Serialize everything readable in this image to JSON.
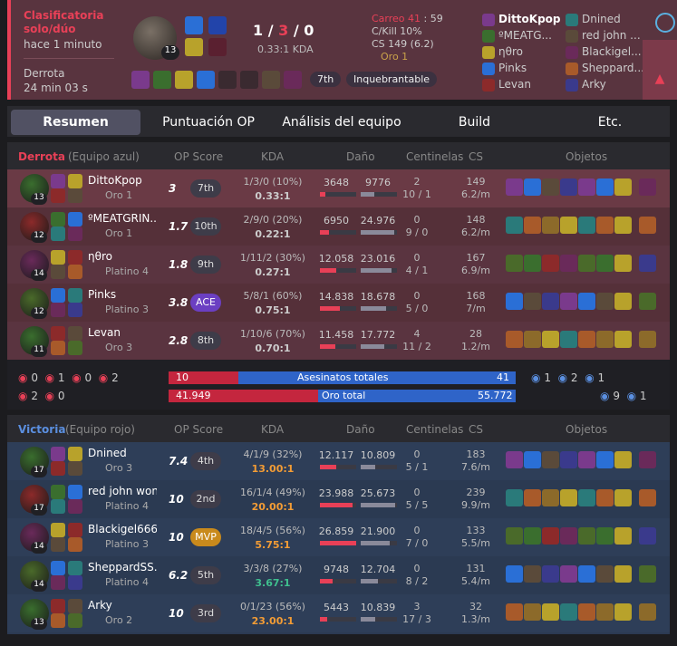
{
  "summary": {
    "queue": "Clasificatoria solo/dúo",
    "ago": "hace 1 minuto",
    "result": "Derrota",
    "duration": "24 min 03 s",
    "champ_level": "13",
    "kills": "1",
    "deaths": "3",
    "assists": "0",
    "kda_ratio": "0.33:1 KDA",
    "placement": "7th",
    "badge": "Inquebrantable",
    "carry": "Carreo 41",
    "carry_time": "59",
    "ckill": "C/Kill 10%",
    "cs": "CS 149 (6.2)",
    "tier": "Oro 1",
    "team_blue": [
      "DittoKpop",
      "ºMEATG...",
      "ηθro",
      "Pinks",
      "Levan"
    ],
    "team_red": [
      "Dnined",
      "red john ...",
      "Blackigel...",
      "Sheppard...",
      "Arky"
    ]
  },
  "tabs": [
    "Resumen",
    "Puntuación OP",
    "Análisis del equipo",
    "Build",
    "Etc."
  ],
  "blue": {
    "result": "Derrota",
    "team_label": "(Equipo azul)",
    "headers": [
      "OP Score",
      "KDA",
      "Daño",
      "Centinelas",
      "CS",
      "Objetos"
    ],
    "players": [
      {
        "name": "DittoKpop",
        "rank": "Oro 1",
        "lvl": "13",
        "score": "3",
        "place": "7th",
        "kda": "1/3/0 (10%)",
        "ratio": "0.33:1",
        "dmg1": "3648",
        "dmg2": "9776",
        "f1": 0.14,
        "f2": 0.38,
        "wards": "2",
        "wards2": "10 / 1",
        "cs": "149",
        "csm": "6.2/m"
      },
      {
        "name": "ºMEATGRIN...",
        "rank": "Oro 1",
        "lvl": "12",
        "score": "1.7",
        "place": "10th",
        "kda": "2/9/0 (20%)",
        "ratio": "0.22:1",
        "dmg1": "6950",
        "dmg2": "24.976",
        "f1": 0.26,
        "f2": 0.93,
        "wards": "0",
        "wards2": "9 / 0",
        "cs": "148",
        "csm": "6.2/m"
      },
      {
        "name": "ηθro",
        "rank": "Platino 4",
        "lvl": "14",
        "score": "1.8",
        "place": "9th",
        "kda": "1/11/2 (30%)",
        "ratio": "0.27:1",
        "dmg1": "12.058",
        "dmg2": "23.016",
        "f1": 0.45,
        "f2": 0.86,
        "wards": "0",
        "wards2": "4 / 1",
        "cs": "167",
        "csm": "6.9/m"
      },
      {
        "name": "Pinks",
        "rank": "Platino 3",
        "lvl": "12",
        "score": "3.8",
        "place": "ACE",
        "kda": "5/8/1 (60%)",
        "ratio": "0.75:1",
        "dmg1": "14.838",
        "dmg2": "18.678",
        "f1": 0.55,
        "f2": 0.7,
        "wards": "0",
        "wards2": "5 / 0",
        "cs": "168",
        "csm": "7/m"
      },
      {
        "name": "Levan",
        "rank": "Oro 3",
        "lvl": "11",
        "score": "2.8",
        "place": "8th",
        "kda": "1/10/6 (70%)",
        "ratio": "0.70:1",
        "dmg1": "11.458",
        "dmg2": "17.772",
        "f1": 0.43,
        "f2": 0.66,
        "wards": "4",
        "wards2": "11 / 2",
        "cs": "28",
        "csm": "1.2/m"
      }
    ]
  },
  "objectives": {
    "blue_top": [
      "0",
      "1",
      "0",
      "2"
    ],
    "blue_bot": [
      "2",
      "0"
    ],
    "red_top": [
      "1",
      "2",
      "1"
    ],
    "red_bot": [
      "9",
      "1"
    ],
    "kills_left": "10",
    "kills_label": "Asesinatos totales",
    "kills_right": "41",
    "gold_left": "41.949",
    "gold_label": "Oro total",
    "gold_right": "55.772",
    "kills_frac": 0.2,
    "gold_frac": 0.43
  },
  "red": {
    "result": "Victoria",
    "team_label": "(Equipo rojo)",
    "headers": [
      "OP Score",
      "KDA",
      "Daño",
      "Centinelas",
      "CS",
      "Objetos"
    ],
    "players": [
      {
        "name": "Dnined",
        "rank": "Oro 3",
        "lvl": "17",
        "score": "7.4",
        "place": "4th",
        "kda": "4/1/9 (32%)",
        "ratio": "13.00:1",
        "dmg1": "12.117",
        "dmg2": "10.809",
        "f1": 0.45,
        "f2": 0.4,
        "wards": "0",
        "wards2": "5 / 1",
        "cs": "183",
        "csm": "7.6/m"
      },
      {
        "name": "red john won",
        "rank": "Platino 4",
        "lvl": "17",
        "score": "10",
        "place": "2nd",
        "kda": "16/1/4 (49%)",
        "ratio": "20.00:1",
        "dmg1": "23.988",
        "dmg2": "25.673",
        "f1": 0.89,
        "f2": 0.95,
        "wards": "0",
        "wards2": "5 / 5",
        "cs": "239",
        "csm": "9.9/m"
      },
      {
        "name": "Blackigel666",
        "rank": "Platino 3",
        "lvl": "14",
        "score": "10",
        "place": "MVP",
        "kda": "18/4/5 (56%)",
        "ratio": "5.75:1",
        "dmg1": "26.859",
        "dmg2": "21.900",
        "f1": 1.0,
        "f2": 0.81,
        "wards": "0",
        "wards2": "7 / 0",
        "cs": "133",
        "csm": "5.5/m"
      },
      {
        "name": "SheppardSS...",
        "rank": "Platino 4",
        "lvl": "14",
        "score": "6.2",
        "place": "5th",
        "kda": "3/3/8 (27%)",
        "ratio": "3.67:1",
        "dmg1": "9748",
        "dmg2": "12.704",
        "f1": 0.36,
        "f2": 0.47,
        "wards": "0",
        "wards2": "8 / 2",
        "cs": "131",
        "csm": "5.4/m"
      },
      {
        "name": "Arky",
        "rank": "Oro 2",
        "lvl": "13",
        "score": "10",
        "place": "3rd",
        "kda": "0/1/23 (56%)",
        "ratio": "23.00:1",
        "dmg1": "5443",
        "dmg2": "10.839",
        "f1": 0.2,
        "f2": 0.4,
        "wards": "3",
        "wards2": "17 / 3",
        "cs": "32",
        "csm": "1.3/m"
      }
    ]
  }
}
